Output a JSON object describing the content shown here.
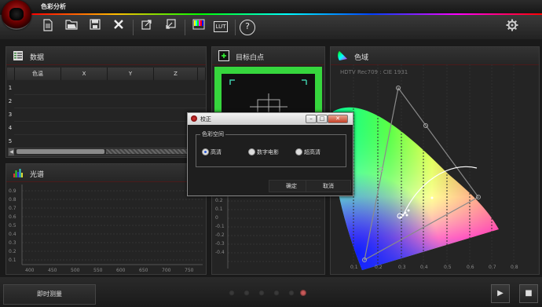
{
  "app": {
    "title": "色彩分析"
  },
  "toolbar": {
    "icons": [
      "new-document-icon",
      "open-folder-icon",
      "save-icon",
      "delete-icon",
      "export-icon",
      "import-icon",
      "color-bars-icon",
      "lut-icon",
      "help-icon",
      "settings-icon"
    ],
    "lut_label": "LUT",
    "help_label": "?"
  },
  "data_panel": {
    "title": "数据",
    "columns": [
      "色温",
      "X",
      "Y",
      "Z"
    ],
    "rows": [
      "1",
      "2",
      "3",
      "4",
      "5"
    ]
  },
  "spectrum_panel": {
    "title": "光谱",
    "y_ticks": [
      "0.9",
      "0.8",
      "0.7",
      "0.6",
      "0.5",
      "0.4",
      "0.3",
      "0.2",
      "0.1"
    ],
    "x_ticks": [
      "400",
      "450",
      "500",
      "550",
      "600",
      "650",
      "700",
      "750"
    ]
  },
  "whitepoint_panel": {
    "title": "目标白点",
    "y_ticks": [
      "0.2",
      "0.1",
      "0",
      "-0.1",
      "-0.2",
      "-0.3",
      "-0.4"
    ]
  },
  "gamut_panel": {
    "title": "色域",
    "subtitle": "HDTV Rec709 : CIE 1931",
    "x_ticks": [
      "0.1",
      "0.2",
      "0.3",
      "0.4",
      "0.5",
      "0.6",
      "0.7",
      "0.8"
    ]
  },
  "dialog": {
    "title": "校正",
    "group_label": "色彩空间",
    "options": [
      "高清",
      "数字电影",
      "超高清"
    ],
    "selected": "高清",
    "ok": "确定",
    "cancel": "取消"
  },
  "bottom": {
    "measure_button": "即时测量",
    "page_dots": 6,
    "active_dot": 5
  },
  "colors": {
    "accent": "#c95a5a",
    "gamut_line": "#8a8a8a"
  }
}
